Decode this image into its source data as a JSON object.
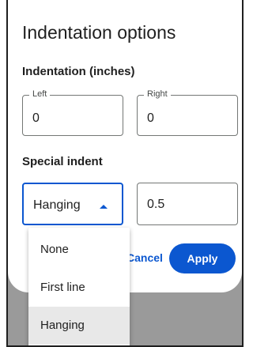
{
  "dialog": {
    "title": "Indentation options",
    "indentation_heading": "Indentation (inches)",
    "left_field": {
      "label": "Left",
      "value": "0"
    },
    "right_field": {
      "label": "Right",
      "value": "0"
    },
    "special_heading": "Special indent",
    "special_select": {
      "value": "Hanging"
    },
    "special_amount": {
      "value": "0.5"
    },
    "cancel_label": "Cancel",
    "apply_label": "Apply"
  },
  "dropdown": {
    "items": [
      {
        "label": "None"
      },
      {
        "label": "First line"
      },
      {
        "label": "Hanging"
      }
    ],
    "selected": "Hanging"
  },
  "colors": {
    "accent": "#0b57d0",
    "backdrop": "#9a9a9a",
    "selected_item": "#e8e8e8"
  },
  "icons": {
    "select_arrow": "triangle-up-icon"
  }
}
